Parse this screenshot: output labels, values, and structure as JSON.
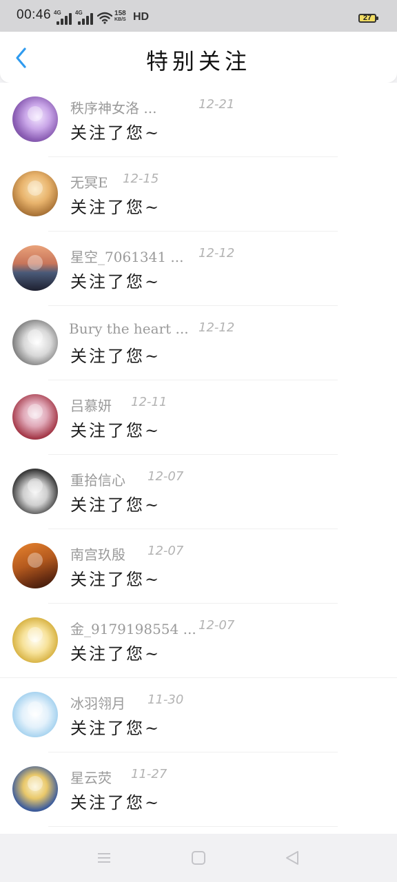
{
  "status_bar": {
    "time": "00:46",
    "signal1_tag": "4G",
    "signal2_tag": "4G",
    "net_speed_value": "158",
    "net_speed_unit": "KB/S",
    "hd_label": "HD",
    "battery_level": "27",
    "battery_color": "#f2dd64"
  },
  "header": {
    "title": "特别关注",
    "back_icon": "chevron-left-icon",
    "accent_color": "#2f9bef"
  },
  "items": [
    {
      "name": "秩序神女洛 ...",
      "date": "12-21",
      "message": "关注了您~"
    },
    {
      "name": "无冥E",
      "date": "12-15",
      "message": "关注了您~"
    },
    {
      "name": "星空_7061341 ...",
      "date": "12-12",
      "message": "关注了您~"
    },
    {
      "name": "Bury the heart ...",
      "date": "12-12",
      "message": "关注了您~"
    },
    {
      "name": "吕慕妍",
      "date": "12-11",
      "message": "关注了您~"
    },
    {
      "name": "重拾信心",
      "date": "12-07",
      "message": "关注了您~"
    },
    {
      "name": "南宫玖殷",
      "date": "12-07",
      "message": "关注了您~"
    },
    {
      "name": "金_9179198554 ...",
      "date": "12-07",
      "message": "关注了您~"
    },
    {
      "name": "冰羽翎月",
      "date": "11-30",
      "message": "关注了您~"
    },
    {
      "name": "星云荧",
      "date": "11-27",
      "message": "关注了您~"
    }
  ],
  "bottom_nav": {
    "menu_icon": "menu-icon",
    "home_icon": "home-square-icon",
    "back_icon": "back-triangle-icon"
  }
}
